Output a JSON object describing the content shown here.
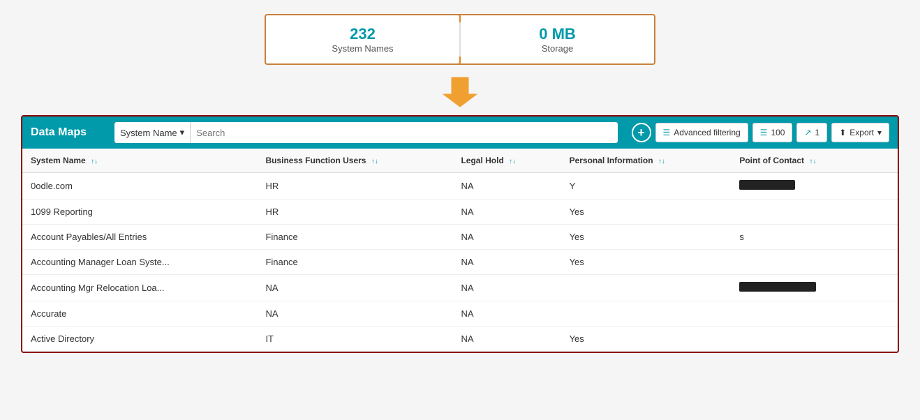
{
  "stats": {
    "system_names_count": "232",
    "system_names_label": "System Names",
    "storage_count": "0 MB",
    "storage_label": "Storage"
  },
  "header": {
    "title": "Data Maps",
    "search_dropdown": "System Name",
    "search_placeholder": "Search",
    "add_button_label": "+",
    "advanced_filtering_label": "Advanced filtering",
    "records_count": "100",
    "pages_count": "1",
    "export_label": "Export"
  },
  "table": {
    "columns": [
      {
        "id": "system_name",
        "label": "System Name"
      },
      {
        "id": "business_function",
        "label": "Business Function Users"
      },
      {
        "id": "legal_hold",
        "label": "Legal Hold"
      },
      {
        "id": "personal_info",
        "label": "Personal Information"
      },
      {
        "id": "point_of_contact",
        "label": "Point of Contact"
      }
    ],
    "rows": [
      {
        "system_name": "0odle.com",
        "business_function": "HR",
        "legal_hold": "NA",
        "personal_info": "Y",
        "point_of_contact": "redacted",
        "poc_type": "redacted-sm"
      },
      {
        "system_name": "1099 Reporting",
        "business_function": "HR",
        "legal_hold": "NA",
        "personal_info": "Yes",
        "point_of_contact": "",
        "poc_type": "none"
      },
      {
        "system_name": "Account Payables/All Entries",
        "business_function": "Finance",
        "legal_hold": "NA",
        "personal_info": "Yes",
        "point_of_contact": "s",
        "poc_type": "text"
      },
      {
        "system_name": "Accounting Manager Loan Syste...",
        "business_function": "Finance",
        "legal_hold": "NA",
        "personal_info": "Yes",
        "point_of_contact": "",
        "poc_type": "none"
      },
      {
        "system_name": "Accounting Mgr Relocation Loa...",
        "business_function": "NA",
        "legal_hold": "NA",
        "personal_info": "",
        "point_of_contact": "redacted",
        "poc_type": "redacted-lg"
      },
      {
        "system_name": "Accurate",
        "business_function": "NA",
        "legal_hold": "NA",
        "personal_info": "",
        "point_of_contact": "",
        "poc_type": "none"
      },
      {
        "system_name": "Active Directory",
        "business_function": "IT",
        "legal_hold": "NA",
        "personal_info": "Yes",
        "point_of_contact": "",
        "poc_type": "none"
      }
    ]
  }
}
